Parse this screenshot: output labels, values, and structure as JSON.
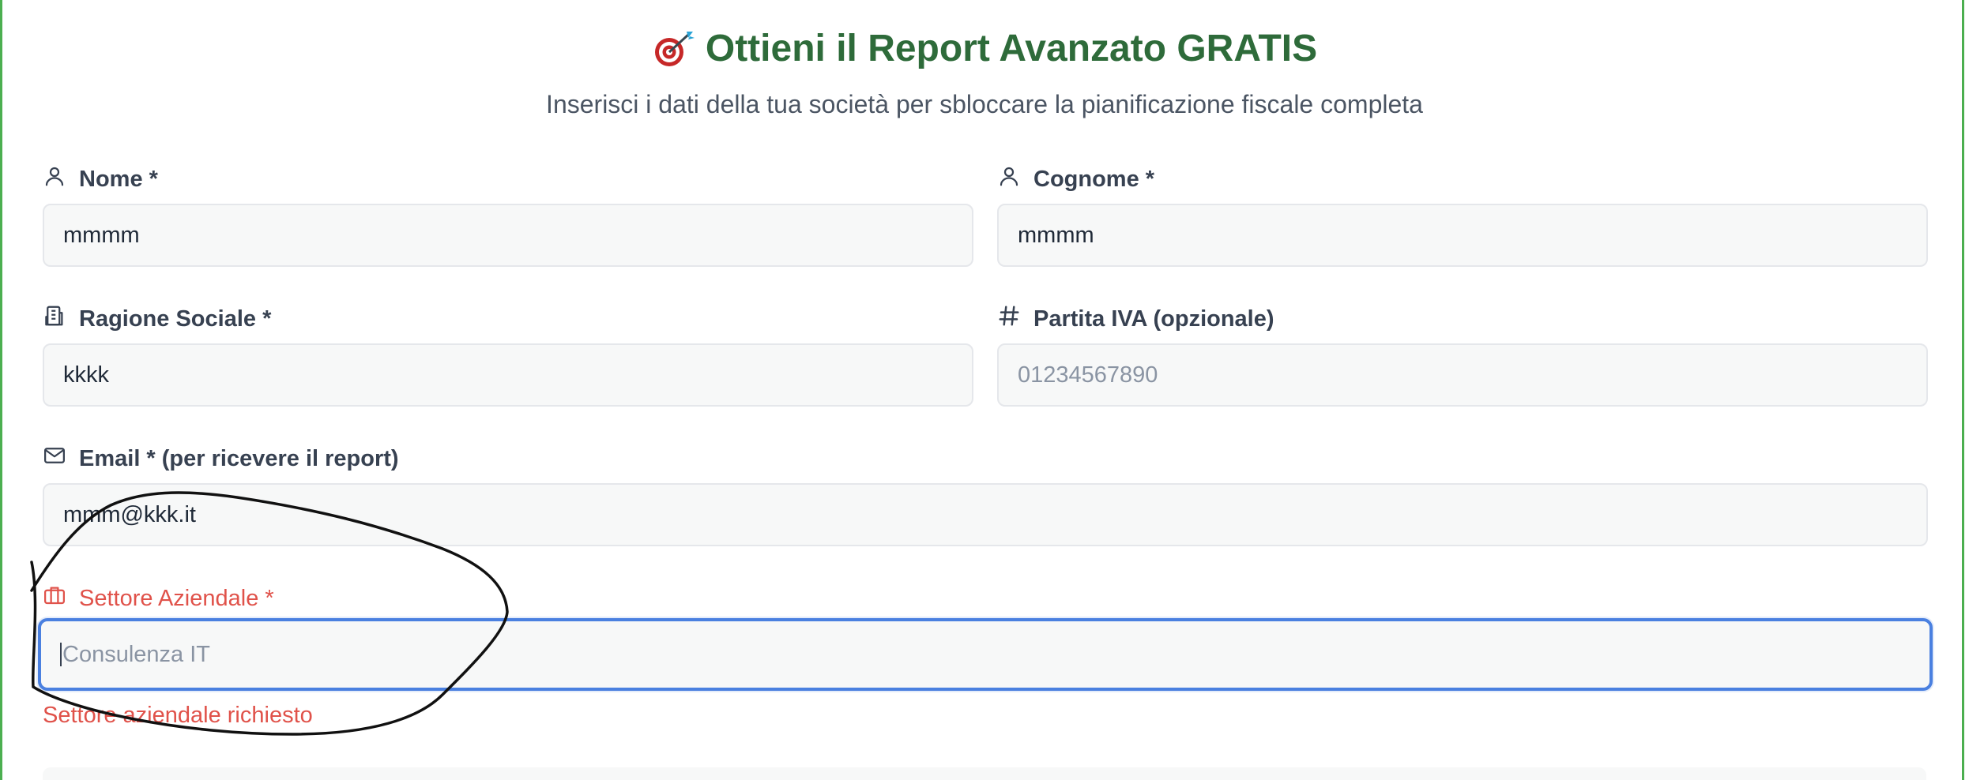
{
  "header": {
    "icon": "target-dart-icon",
    "title": "Ottieni il Report Avanzato GRATIS",
    "subtitle": "Inserisci i dati della tua società per sbloccare la pianificazione fiscale completa"
  },
  "form": {
    "nome": {
      "label": "Nome *",
      "icon": "user-icon",
      "value": "mmmm"
    },
    "cognome": {
      "label": "Cognome *",
      "icon": "user-icon",
      "value": "mmmm"
    },
    "ragione_sociale": {
      "label": "Ragione Sociale *",
      "icon": "building-icon",
      "value": "kkkk"
    },
    "partita_iva": {
      "label": "Partita IVA (opzionale)",
      "icon": "hash-icon",
      "placeholder": "01234567890"
    },
    "email": {
      "label": "Email * (per ricevere il report)",
      "icon": "mail-icon",
      "value": "mmm@kkk.it"
    },
    "settore": {
      "label": "Settore Aziendale *",
      "icon": "briefcase-icon",
      "placeholder": "Consulenza IT",
      "error": "Settore aziendale richiesto"
    }
  },
  "colors": {
    "title": "#2e6b3a",
    "frame_border": "#4caf50",
    "error": "#e0524a",
    "focus_border": "#4a80e0"
  }
}
